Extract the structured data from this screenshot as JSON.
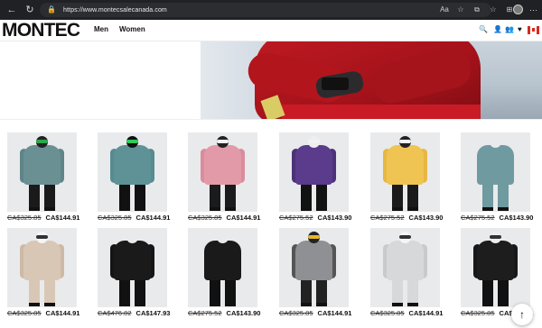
{
  "browser": {
    "url": "https://www.montecsalecanada.com",
    "back_icon": "←",
    "reload_icon": "↻",
    "lock_icon": "🔒",
    "toolbar_icons": [
      "Aa",
      "☆",
      "⧉",
      "☆",
      "⊞"
    ],
    "more_icon": "⋯"
  },
  "site": {
    "logo": "MONTEC",
    "nav": [
      "Men",
      "Women"
    ],
    "header_icons": [
      "search-icon",
      "user-icon",
      "user-plus-icon",
      "heart-icon"
    ],
    "header_glyphs": [
      "🔍",
      "👤",
      "👥",
      "♥"
    ]
  },
  "hero": {
    "description": "person in red ski suit holding phone"
  },
  "products": [
    {
      "old_price": "CA$325.85",
      "price": "CA$144.91",
      "jacket": "#6b9093",
      "sleeve": "#5f8588",
      "pants": "#1a1a1a",
      "helmet": "#222",
      "goggle": "#2aa84a"
    },
    {
      "old_price": "CA$325.85",
      "price": "CA$144.91",
      "jacket": "#5e9297",
      "sleeve": "#578b90",
      "pants": "#111",
      "helmet": "#111",
      "goggle": "#2ecc5a"
    },
    {
      "old_price": "CA$325.85",
      "price": "CA$144.91",
      "jacket": "#e39aa8",
      "sleeve": "#d98d9c",
      "pants": "#1b1b1b",
      "helmet": "#222",
      "goggle": "#f2f2f2"
    },
    {
      "old_price": "CA$275.52",
      "price": "CA$143.90",
      "jacket": "#5a3b8c",
      "sleeve": "#4d3279",
      "pants": "#121212",
      "helmet": "#eee",
      "goggle": "#f2f2f2"
    },
    {
      "old_price": "CA$275.52",
      "price": "CA$143.90",
      "jacket": "#f0c452",
      "sleeve": "#e6b843",
      "pants": "#1b1b1b",
      "helmet": "#222",
      "goggle": "#f2f2f2"
    },
    {
      "old_price": "CA$275.52",
      "price": "CA$143.90",
      "jacket": "#6f9aa0",
      "sleeve": "#e9eaec",
      "pants": "#6f9aa0",
      "helmet": "#e9eaec",
      "goggle": "#e9eaec"
    },
    {
      "old_price": "CA$325.85",
      "price": "CA$144.91",
      "jacket": "#d9c7b6",
      "sleeve": "#cdb9a6",
      "pants": "#d9c7b6",
      "helmet": "#f5f5f5",
      "goggle": "#333"
    },
    {
      "old_price": "CA$476.82",
      "price": "CA$147.93",
      "jacket": "#1a1a1a",
      "sleeve": "#151515",
      "pants": "#111",
      "helmet": "#e9eaec",
      "goggle": "#e9eaec"
    },
    {
      "old_price": "CA$275.52",
      "price": "CA$143.90",
      "jacket": "#1a1a1a",
      "sleeve": "#e9eaec",
      "pants": "#111",
      "helmet": "#e9eaec",
      "goggle": "#e9eaec"
    },
    {
      "old_price": "CA$325.85",
      "price": "CA$144.91",
      "jacket": "#8e9093",
      "sleeve": "#555",
      "pants": "#222",
      "helmet": "#222",
      "goggle": "#e6b62c"
    },
    {
      "old_price": "CA$325.85",
      "price": "CA$144.91",
      "jacket": "#d6d8da",
      "sleeve": "#c8cacc",
      "pants": "#d6d8da",
      "helmet": "#f5f5f5",
      "goggle": "#333"
    },
    {
      "old_price": "CA$325.85",
      "price": "CA$144.91",
      "jacket": "#1d1d1d",
      "sleeve": "#181818",
      "pants": "#111",
      "helmet": "#eee",
      "goggle": "#333"
    }
  ],
  "scroll_top_icon": "↑"
}
